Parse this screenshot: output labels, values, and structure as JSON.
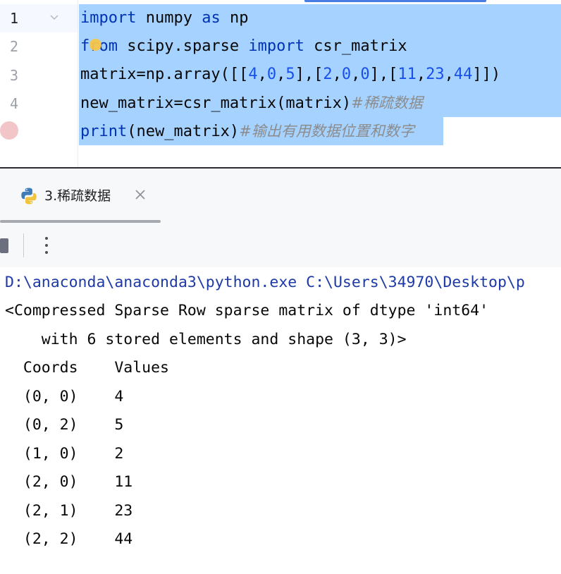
{
  "editor": {
    "line_numbers": [
      "1",
      "2",
      "3",
      "4"
    ],
    "lines": [
      [
        {
          "t": "import",
          "c": "kw"
        },
        {
          "t": " numpy "
        },
        {
          "t": "as",
          "c": "kw"
        },
        {
          "t": " np"
        }
      ],
      [
        {
          "t": "from",
          "c": "kw"
        },
        {
          "t": " scipy.sparse "
        },
        {
          "t": "import",
          "c": "kw"
        },
        {
          "t": " csr_matrix"
        }
      ],
      [
        {
          "t": "matrix=np.array([["
        },
        {
          "t": "4",
          "c": "num"
        },
        {
          "t": ","
        },
        {
          "t": "0",
          "c": "num"
        },
        {
          "t": ","
        },
        {
          "t": "5",
          "c": "num"
        },
        {
          "t": "],["
        },
        {
          "t": "2",
          "c": "num"
        },
        {
          "t": ","
        },
        {
          "t": "0",
          "c": "num"
        },
        {
          "t": ","
        },
        {
          "t": "0",
          "c": "num"
        },
        {
          "t": "],["
        },
        {
          "t": "11",
          "c": "num"
        },
        {
          "t": ","
        },
        {
          "t": "23",
          "c": "num"
        },
        {
          "t": ","
        },
        {
          "t": "44",
          "c": "num"
        },
        {
          "t": "]])"
        }
      ],
      [
        {
          "t": "new_matrix=csr_matrix(matrix)"
        },
        {
          "t": "#稀疏数据",
          "c": "cm"
        }
      ],
      [
        {
          "t": "print",
          "c": "kw"
        },
        {
          "t": "(new_matrix)"
        },
        {
          "t": "#输出有用数据位置和数字",
          "c": "cm"
        }
      ]
    ],
    "colors": {
      "selection": "#a6d2ff",
      "keyword": "#0033b3",
      "number": "#1750eb",
      "comment": "#8c8c8c"
    }
  },
  "run_window": {
    "tab_label": "3.稀疏数据",
    "tab_icon": "python-icon",
    "toolbar": {
      "stop_icon": "stop-icon",
      "more_icon": "more-options-icon"
    }
  },
  "console": {
    "lines": [
      "D:\\anaconda\\anaconda3\\python.exe C:\\Users\\34970\\Desktop\\p",
      "<Compressed Sparse Row sparse matrix of dtype 'int64'",
      "    with 6 stored elements and shape (3, 3)>",
      "  Coords    Values",
      "  (0, 0)    4",
      "  (0, 2)    5",
      "  (1, 0)    2",
      "  (2, 0)    11",
      "  (2, 1)    23",
      "  (2, 2)    44"
    ]
  }
}
